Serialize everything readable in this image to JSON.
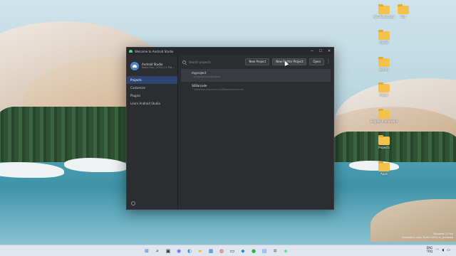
{
  "window": {
    "title": "Welcome to Android Studio",
    "controls": {
      "minimize": "—",
      "maximize": "☐",
      "close": "✕"
    }
  },
  "app_info": {
    "name": "Android Studio",
    "version": "Koala Fea | 2024.1.1 Pat..."
  },
  "sidebar": {
    "items": [
      {
        "label": "Projects",
        "active": true
      },
      {
        "label": "Customize",
        "active": false
      },
      {
        "label": "Plugins",
        "active": false
      },
      {
        "label": "Learn Android Studio",
        "active": false
      }
    ]
  },
  "search": {
    "placeholder": "Search projects",
    "value": ""
  },
  "toolbar": {
    "new_project": "New Project",
    "new_flutter_project": "New Flutter Project",
    "open": "Open",
    "more": "⋮"
  },
  "projects": [
    {
      "name": "myproject",
      "path": "~\\myproject\\myproject"
    },
    {
      "name": "SEBarcode",
      "path": "~\\Desktop\\mauzzhaus\\SEBarcodeAndroid"
    }
  ],
  "desktop_icons": [
    {
      "label": "Abc Repository",
      "icon": "folder-icon"
    },
    {
      "label": "Ext",
      "icon": "folder-icon"
    },
    {
      "label": "RunW",
      "icon": "folder-icon"
    },
    {
      "label": "Library",
      "icon": "folder-icon"
    },
    {
      "label": "Kaleit",
      "icon": "folder-icon"
    },
    {
      "label": "Singleb Framework",
      "icon": "folder-icon"
    },
    {
      "label": "Projects",
      "icon": "folder-icon"
    },
    {
      "label": "Apps",
      "icon": "folder-icon"
    }
  ],
  "watermark": {
    "line1": "Windows 11 Pro",
    "line2": "Evaluation copy. Build 22631.ni_prelease"
  },
  "taskbar": {
    "apps": [
      {
        "name": "start-icon",
        "glyph": "⊞",
        "color": "#1a73d9"
      },
      {
        "name": "search-icon",
        "glyph": "⌕",
        "color": "#222222"
      },
      {
        "name": "task-view-icon",
        "glyph": "▣",
        "color": "#333333"
      },
      {
        "name": "chat-icon",
        "glyph": "◉",
        "color": "#6b5bd6"
      },
      {
        "name": "edge-icon",
        "glyph": "◐",
        "color": "#1e9bd7"
      },
      {
        "name": "file-explorer-icon",
        "glyph": "▰",
        "color": "#f3b736"
      },
      {
        "name": "store-icon",
        "glyph": "▦",
        "color": "#2a78d5"
      },
      {
        "name": "chrome-icon",
        "glyph": "◍",
        "color": "#e04536"
      },
      {
        "name": "terminal-icon",
        "glyph": "▭",
        "color": "#2b2b2b"
      },
      {
        "name": "vscode-icon",
        "glyph": "◆",
        "color": "#1f8ad2"
      },
      {
        "name": "whatsapp-icon",
        "glyph": "●",
        "color": "#22b34b"
      },
      {
        "name": "notepad-icon",
        "glyph": "▤",
        "color": "#4b8fd9"
      },
      {
        "name": "settings-icon",
        "glyph": "✲",
        "color": "#6a6a6a"
      },
      {
        "name": "android-studio-icon",
        "glyph": "◈",
        "color": "#3ddc84"
      }
    ],
    "tray": {
      "lang1": "ENG",
      "lang2": "TRQ",
      "wifi": "◠",
      "volume": "◖",
      "battery": "▭"
    }
  },
  "colors": {
    "window_bg": "#2b2d30",
    "accent_selected": "#2e436e",
    "text_primary": "#dfe1e5",
    "text_secondary": "#6f737a"
  }
}
